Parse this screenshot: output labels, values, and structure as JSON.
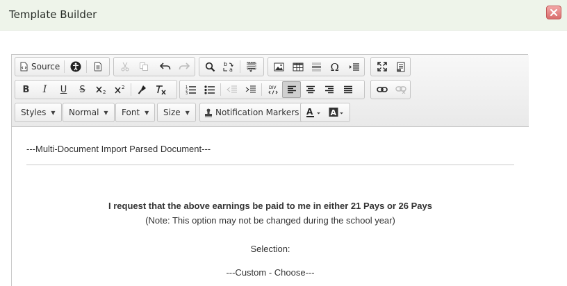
{
  "window": {
    "title": "Template Builder"
  },
  "toolbar": {
    "source_label": "Source",
    "styles_label": "Styles",
    "format_label": "Normal",
    "font_label": "Font",
    "size_label": "Size",
    "notification_label": "Notification Markers",
    "icons": [
      "source-icon",
      "accessibility-icon",
      "templates-icon",
      "cut-icon",
      "copy-icon",
      "undo-icon",
      "redo-icon",
      "find-icon",
      "replace-icon",
      "select-all-icon",
      "image-icon",
      "table-icon",
      "horizontal-line-icon",
      "special-char-icon",
      "indent-block-icon",
      "maximize-icon",
      "show-blocks-icon",
      "bold-icon",
      "italic-icon",
      "underline-icon",
      "strike-icon",
      "subscript-icon",
      "superscript-icon",
      "copy-format-icon",
      "remove-format-icon",
      "numbered-list-icon",
      "bulleted-list-icon",
      "outdent-icon",
      "indent-icon",
      "div-icon",
      "align-left-icon",
      "align-center-icon",
      "align-right-icon",
      "justify-icon",
      "link-icon",
      "unlink-icon",
      "text-color-icon",
      "background-color-icon"
    ]
  },
  "content": {
    "header_line": "---Multi-Document Import Parsed Document---",
    "request_line": "I request that the above earnings be paid to me in either 21 Pays or 26 Pays",
    "note_line": "(Note: This option may not be changed during the school year)",
    "selection_label": "Selection:",
    "choose_line": "---Custom - Choose---"
  }
}
